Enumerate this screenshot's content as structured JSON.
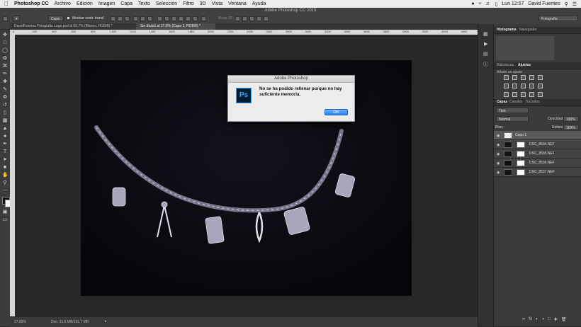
{
  "menubar": {
    "app_name": "Photoshop CC",
    "items": [
      "Archivo",
      "Edición",
      "Imagen",
      "Capa",
      "Texto",
      "Selección",
      "Filtro",
      "3D",
      "Vista",
      "Ventana",
      "Ayuda"
    ],
    "clock": "Lun 12:57",
    "user": "David Fuentes"
  },
  "window": {
    "title": "Adobe Photoshop CC 2015"
  },
  "options": {
    "auto_select_value": "Capa",
    "show_transform_label": "Mostrar contr. transf.",
    "mode_3d_label": "Modo 3D:",
    "workspace_value": "Fotografía"
  },
  "doc_tabs": [
    "DavidFuentes Fotografia Logo.psd al 66,7% (Blanco, RGB/8) *",
    "Sin título1 al 27,8% (Capa 1, RGB/8) *"
  ],
  "ruler": {
    "labels": [
      "0",
      "200",
      "400",
      "600",
      "800",
      "1000",
      "1200",
      "1400",
      "1600",
      "1800",
      "2000",
      "2200",
      "2400",
      "2600",
      "2800",
      "3000",
      "3200",
      "3400",
      "3600",
      "3800",
      "4000",
      "4200",
      "4400",
      "4600"
    ]
  },
  "status": {
    "zoom": "27,83%",
    "doc_info": "Doc: 31,6 MB/191,7 MB"
  },
  "dialog": {
    "title": "Adobe Photoshop",
    "logo_text": "Ps",
    "message": "No se ha podido rellenar porque no hay suficiente memoria.",
    "ok_label": "OK"
  },
  "panels": {
    "top_tabs": [
      "Histograma",
      "Navegador"
    ],
    "mid_tabs": [
      "Bibliotecas",
      "Ajustes"
    ],
    "adjust_hint": "Añadir un ajuste",
    "layer_tabs": [
      "Capas",
      "Canales",
      "Trazados"
    ],
    "filter_value": "Tipo",
    "blend_mode": "Normal",
    "opacity_label": "Opacidad:",
    "opacity_value": "100%",
    "lock_label": "Bloq.:",
    "fill_label": "Relleno:",
    "fill_value": "100%",
    "layers": [
      "Capa 1",
      "DSC_8534.NEF",
      "DSC_8535.NEF",
      "DSC_8536.NEF",
      "DSC_8537.NEF"
    ]
  },
  "colors": {
    "accent_blue": "#31a8ff",
    "ok_button": "#2a7ef0"
  }
}
